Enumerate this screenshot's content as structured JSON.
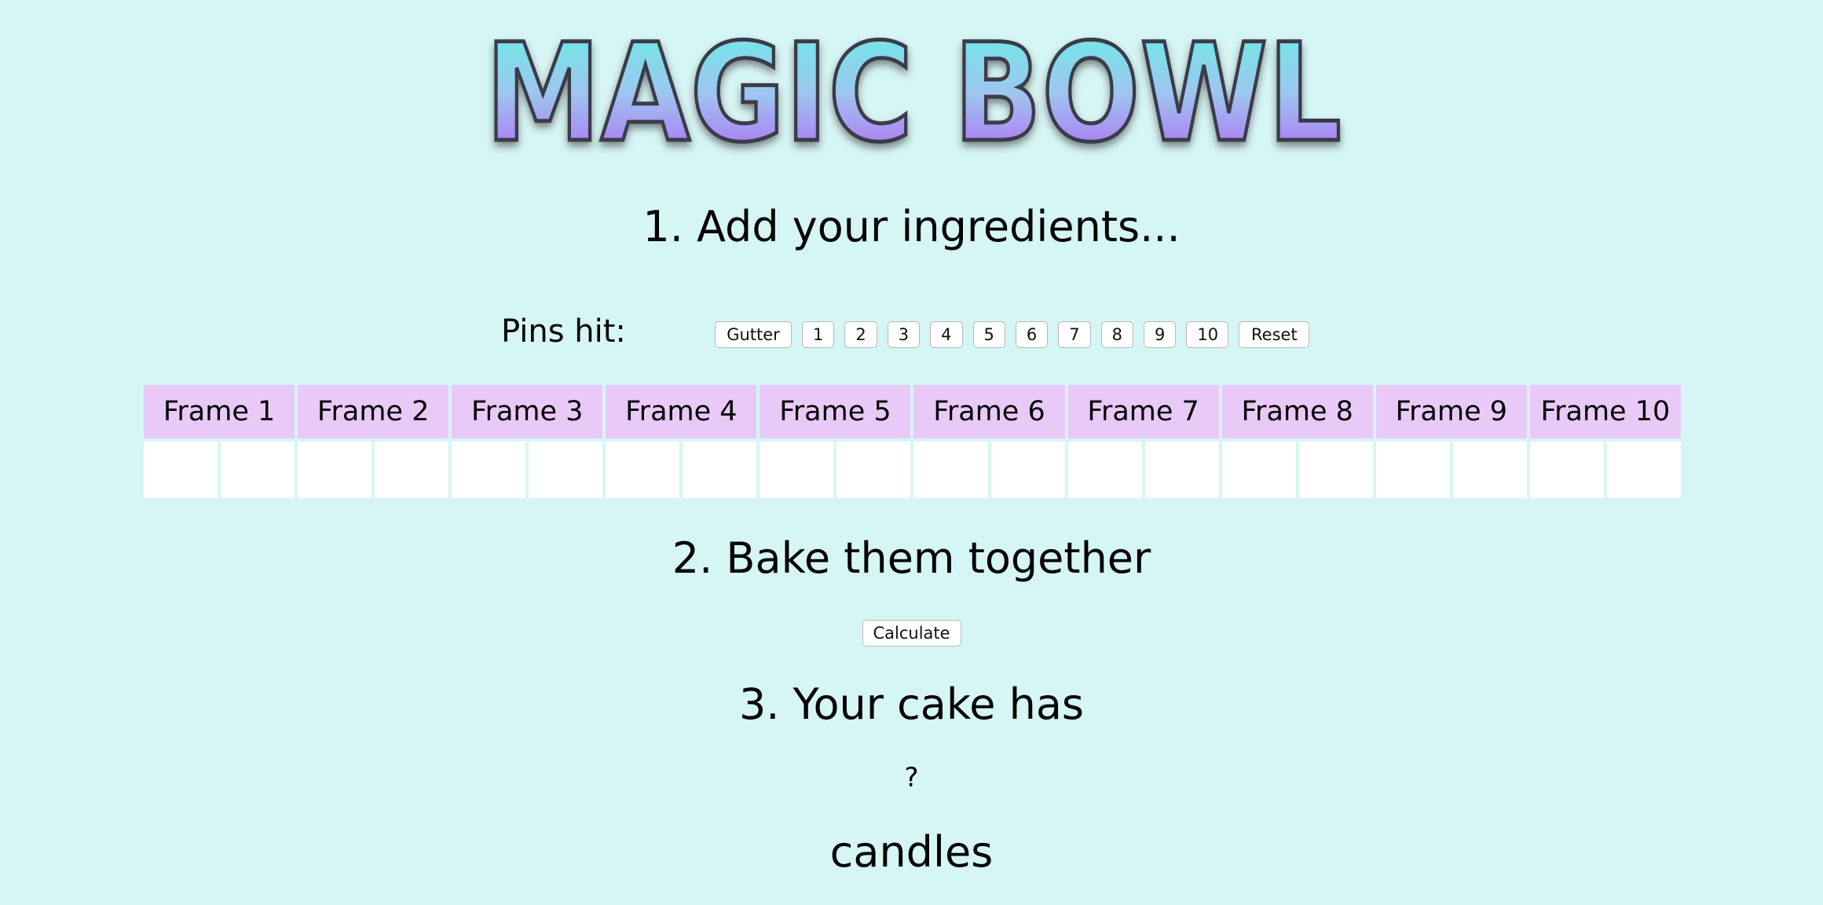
{
  "logo": {
    "text": "MAGIC BOWL"
  },
  "steps": {
    "add": "1. Add your ingredients...",
    "bake": "2. Bake them together",
    "result": "3. Your cake has"
  },
  "pins": {
    "label": "Pins hit:",
    "buttons": [
      "Gutter",
      "1",
      "2",
      "3",
      "4",
      "5",
      "6",
      "7",
      "8",
      "9",
      "10",
      "Reset"
    ]
  },
  "frames": [
    "Frame 1",
    "Frame 2",
    "Frame 3",
    "Frame 4",
    "Frame 5",
    "Frame 6",
    "Frame 7",
    "Frame 8",
    "Frame 9",
    "Frame 10"
  ],
  "calculate_label": "Calculate",
  "score": "?",
  "candles_label": "candles",
  "colors": {
    "background": "#d6f6f5",
    "frame_header": "#e9c9f8",
    "logo_gradient_top": "#62f2e2",
    "logo_gradient_bottom": "#b25cf5"
  }
}
